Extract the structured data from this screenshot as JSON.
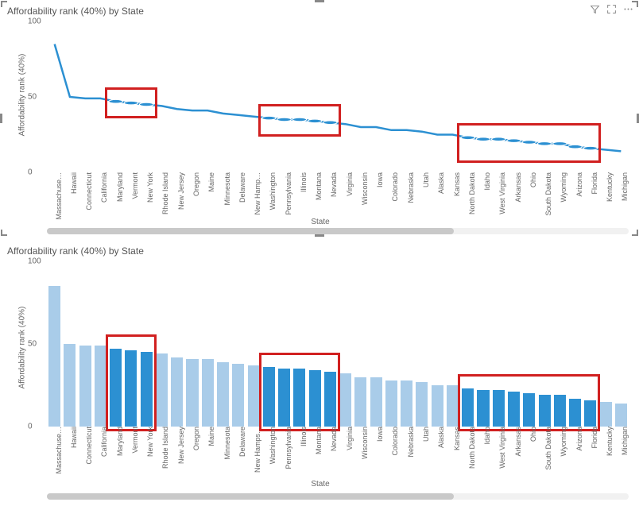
{
  "panel1_title": "Affordability rank (40%) by State",
  "panel2_title": "Affordability rank (40%) by State",
  "y_axis_label": "Affordability rank (40%)",
  "x_axis_label": "State",
  "y_ticks": [
    "0",
    "50",
    "100"
  ],
  "icons": {
    "filter": "filter-icon",
    "focus": "focus-mode-icon",
    "more": "more-options-icon"
  },
  "highlight_groups": [
    {
      "start": 4,
      "end": 6
    },
    {
      "start": 14,
      "end": 18
    },
    {
      "start": 27,
      "end": 35
    }
  ],
  "chart_data": [
    {
      "type": "line",
      "title": "Affordability rank (40%) by State",
      "xlabel": "State",
      "ylabel": "Affordability rank (40%)",
      "ylim": [
        0,
        100
      ],
      "categories": [
        "Massachuse…",
        "Hawaii",
        "Connecticut",
        "California",
        "Maryland",
        "Vermont",
        "New York",
        "Rhode Island",
        "New Jersey",
        "Oregon",
        "Maine",
        "Minnesota",
        "Delaware",
        "New Hamp…",
        "Washington",
        "Pennsylvania",
        "Illinois",
        "Montana",
        "Nevada",
        "Virginia",
        "Wisconsin",
        "Iowa",
        "Colorado",
        "Nebraska",
        "Utah",
        "Alaska",
        "Kansas",
        "North Dakota",
        "Idaho",
        "West Virginia",
        "Arkansas",
        "Ohio",
        "South Dakota",
        "Wyoming",
        "Arizona",
        "Florida",
        "Kentucky",
        "Michigan"
      ],
      "series": [
        {
          "name": "Affordability rank (40%)",
          "values": [
            85,
            50,
            49,
            49,
            47,
            46,
            45,
            44,
            42,
            41,
            41,
            39,
            38,
            37,
            36,
            35,
            35,
            34,
            33,
            32,
            30,
            30,
            28,
            28,
            27,
            25,
            25,
            23,
            22,
            22,
            21,
            20,
            19,
            19,
            17,
            16,
            15,
            14
          ]
        }
      ]
    },
    {
      "type": "bar",
      "title": "Affordability rank (40%) by State",
      "xlabel": "State",
      "ylabel": "Affordability rank (40%)",
      "ylim": [
        0,
        100
      ],
      "categories": [
        "Massachuse…",
        "Hawaii",
        "Connecticut",
        "California",
        "Maryland",
        "Vermont",
        "New York",
        "Rhode Island",
        "New Jersey",
        "Oregon",
        "Maine",
        "Minnesota",
        "Delaware",
        "New Hamps…",
        "Washington",
        "Pennsylvania",
        "Illinois",
        "Montana",
        "Nevada",
        "Virginia",
        "Wisconsin",
        "Iowa",
        "Colorado",
        "Nebraska",
        "Utah",
        "Alaska",
        "Kansas",
        "North Dakota",
        "Idaho",
        "West Virginia",
        "Arkansas",
        "Ohio",
        "South Dakota",
        "Wyoming",
        "Arizona",
        "Florida",
        "Kentucky",
        "Michigan"
      ],
      "series": [
        {
          "name": "Affordability rank (40%)",
          "values": [
            85,
            50,
            49,
            49,
            47,
            46,
            45,
            44,
            42,
            41,
            41,
            39,
            38,
            37,
            36,
            35,
            35,
            34,
            33,
            32,
            30,
            30,
            28,
            28,
            27,
            25,
            25,
            23,
            22,
            22,
            21,
            20,
            19,
            19,
            17,
            16,
            15,
            14
          ]
        }
      ]
    }
  ]
}
